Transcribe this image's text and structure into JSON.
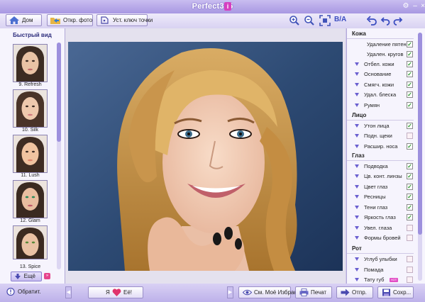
{
  "window": {
    "title": "Perfect365",
    "badge": "i",
    "colors": {
      "accent": "#a898e2",
      "check": "#2c9a2c"
    }
  },
  "toolbar": {
    "home_label": "Дом",
    "open_label": "Откр. фото",
    "keypoints_label": "Уст. ключ точки",
    "ba_label": "B/A"
  },
  "left": {
    "title": "Быстрый вид",
    "thumbs": [
      {
        "label": "9. Refresh"
      },
      {
        "label": "10. Silk"
      },
      {
        "label": "11. Lush"
      },
      {
        "label": "12. Glam"
      },
      {
        "label": "13. Spice"
      }
    ],
    "more_label": "Ещё",
    "more_badge": "»"
  },
  "right": {
    "sections": [
      {
        "name": "Кожа",
        "items": [
          {
            "label": "Удаление пятен",
            "checked": true,
            "arrow": false
          },
          {
            "label": "Удален. кругов",
            "checked": true,
            "arrow": false
          },
          {
            "label": "Отбел. кожи",
            "checked": true,
            "arrow": true
          },
          {
            "label": "Основание",
            "checked": true,
            "arrow": true
          },
          {
            "label": "Смягч. кожи",
            "checked": true,
            "arrow": true
          },
          {
            "label": "Удал. блеска",
            "checked": true,
            "arrow": true
          },
          {
            "label": "Румян",
            "checked": true,
            "arrow": true
          }
        ]
      },
      {
        "name": "Лицо",
        "items": [
          {
            "label": "Утон лица",
            "checked": true,
            "arrow": true
          },
          {
            "label": "Подн. щеки",
            "checked": false,
            "arrow": true
          },
          {
            "label": "Расшир. носа",
            "checked": true,
            "arrow": true
          }
        ]
      },
      {
        "name": "Глаз",
        "items": [
          {
            "label": "Подводка",
            "checked": true,
            "arrow": true
          },
          {
            "label": "Цв. конт. линзы",
            "checked": true,
            "arrow": true
          },
          {
            "label": "Цвет глаз",
            "checked": true,
            "arrow": true
          },
          {
            "label": "Ресницы",
            "checked": true,
            "arrow": true
          },
          {
            "label": "Тени глаз",
            "checked": true,
            "arrow": true
          },
          {
            "label": "Яркость глаз",
            "checked": true,
            "arrow": true
          },
          {
            "label": "Увел. глаза",
            "checked": false,
            "arrow": true
          },
          {
            "label": "Формы бровей",
            "checked": false,
            "arrow": true
          }
        ]
      },
      {
        "name": "Рот",
        "items": [
          {
            "label": "Углуб улыбки",
            "checked": false,
            "arrow": true
          },
          {
            "label": "Помада",
            "checked": false,
            "arrow": true
          },
          {
            "label": "Тату губ",
            "checked": false,
            "arrow": true
          }
        ]
      }
    ],
    "hot_tag": "HOT"
  },
  "bottom": {
    "feedback_label": "Обратит.",
    "like_left": "Я",
    "like_right": "Её!",
    "favorites_label": "См. Моё Избран.",
    "print_label": "Печат",
    "send_label": "Отпр.",
    "save_label": "Сохр..."
  }
}
